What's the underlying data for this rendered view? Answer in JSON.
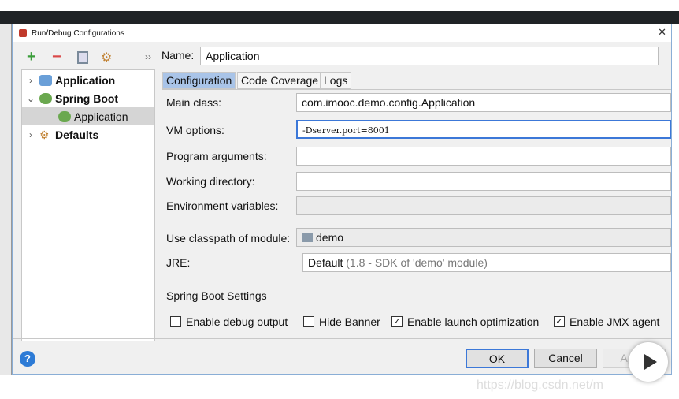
{
  "window": {
    "title": "Run/Debug Configurations"
  },
  "toolbar": {
    "add": "+",
    "remove": "−",
    "more": "››"
  },
  "tree": {
    "items": [
      {
        "label": "Application",
        "expanded": false
      },
      {
        "label": "Spring Boot",
        "expanded": true
      },
      {
        "label": "Application",
        "selected": true
      },
      {
        "label": "Defaults",
        "expanded": false
      }
    ]
  },
  "name": {
    "label": "Name:",
    "value": "Application"
  },
  "tabs": [
    {
      "label": "Configuration",
      "active": true
    },
    {
      "label": "Code Coverage"
    },
    {
      "label": "Logs"
    }
  ],
  "form": {
    "main_class": {
      "label": "Main class:",
      "value": "com.imooc.demo.config.Application"
    },
    "vm_options": {
      "label": "VM options:",
      "value": "-Dserver.port=8001"
    },
    "program_arguments": {
      "label": "Program arguments:",
      "value": ""
    },
    "working_directory": {
      "label": "Working directory:",
      "value": ""
    },
    "environment_variables": {
      "label": "Environment variables:",
      "value": ""
    },
    "classpath": {
      "label": "Use classpath of module:",
      "value": "demo"
    },
    "jre": {
      "label": "JRE:",
      "value": "Default",
      "hint": "(1.8 - SDK of 'demo' module)"
    }
  },
  "spring": {
    "section": "Spring Boot Settings",
    "options": [
      {
        "label": "Enable debug output",
        "checked": false
      },
      {
        "label": "Hide Banner",
        "checked": false
      },
      {
        "label": "Enable launch optimization",
        "checked": true
      },
      {
        "label": "Enable JMX agent",
        "checked": true
      }
    ]
  },
  "buttons": {
    "help": "?",
    "ok": "OK",
    "cancel": "Cancel",
    "apply": "Apply"
  },
  "watermark": "https://blog.csdn.net/m",
  "colors": {
    "accent": "#3c78d8",
    "add": "#3a9d3a",
    "remove": "#d94848",
    "spring": "#6aa84f"
  }
}
